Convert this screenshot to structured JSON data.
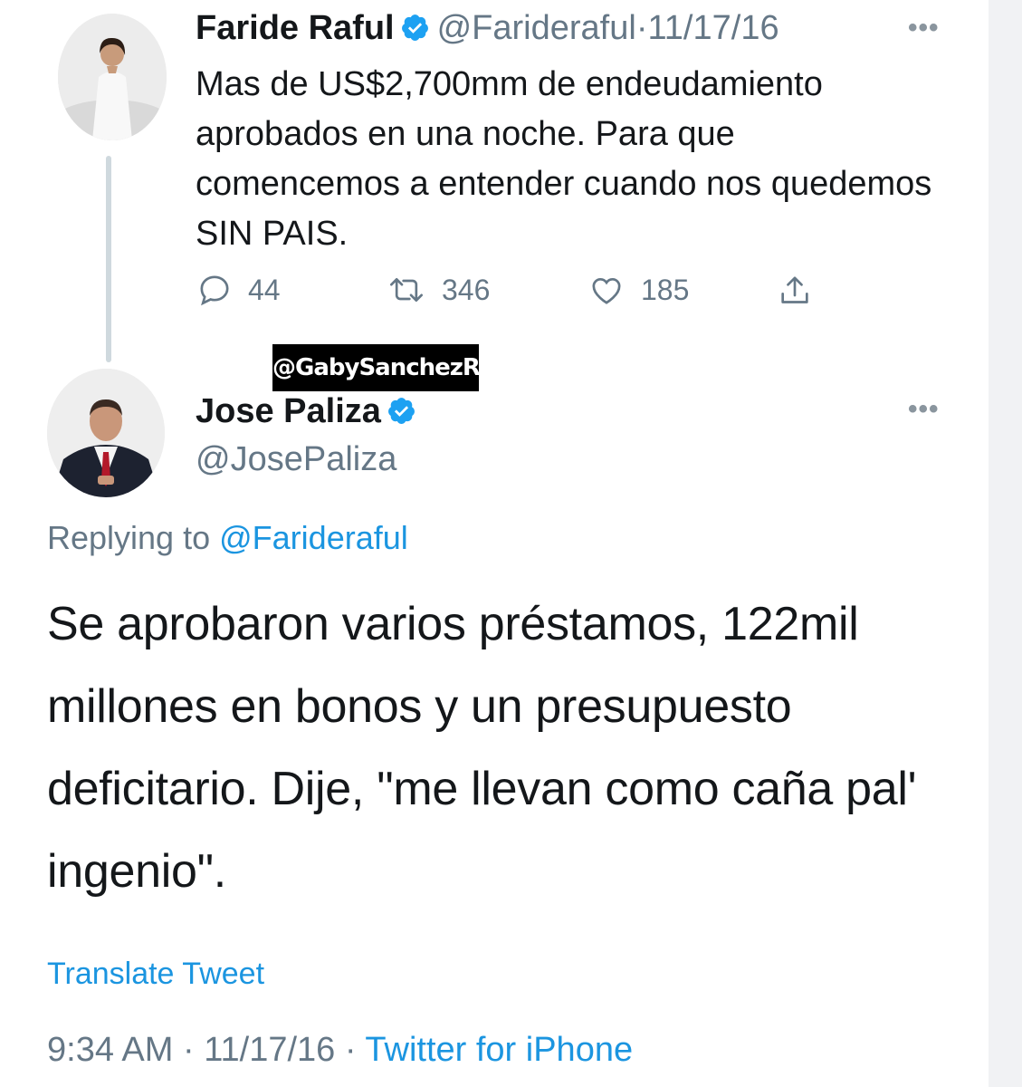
{
  "tweet1": {
    "name": "Faride Raful",
    "handle": "@Farideraful",
    "date": "11/17/16",
    "separator": "·",
    "text": "Mas de US$2,700mm  de endeudamiento aprobados en una noche. Para que comencemos a entender cuando nos quedemos SIN PAIS.",
    "more_label": "•••",
    "stats": {
      "replies": "44",
      "retweets": "346",
      "likes": "185"
    }
  },
  "watermark": "@GabySanchezRD",
  "tweet2": {
    "name": "Jose Paliza",
    "handle": "@JosePaliza",
    "more_label": "•••",
    "replying_prefix": "Replying to",
    "replying_to": "@Farideraful",
    "text": "Se aprobaron varios préstamos, 122mil millones en bonos y un presupuesto deficitario. Dije, \"me llevan como caña pal' ingenio\".",
    "translate_label": "Translate Tweet",
    "time": "9:34 AM",
    "date": "11/17/16",
    "separator": "·",
    "source": "Twitter for iPhone"
  },
  "icons": {
    "reply": "reply-icon",
    "retweet": "retweet-icon",
    "like": "like-icon",
    "share": "share-icon",
    "verified": "verified-badge-icon",
    "more": "more-options-icon"
  },
  "colors": {
    "text": "#14171a",
    "muted": "#657786",
    "link": "#1b95e0",
    "verified": "#1da1f2"
  }
}
